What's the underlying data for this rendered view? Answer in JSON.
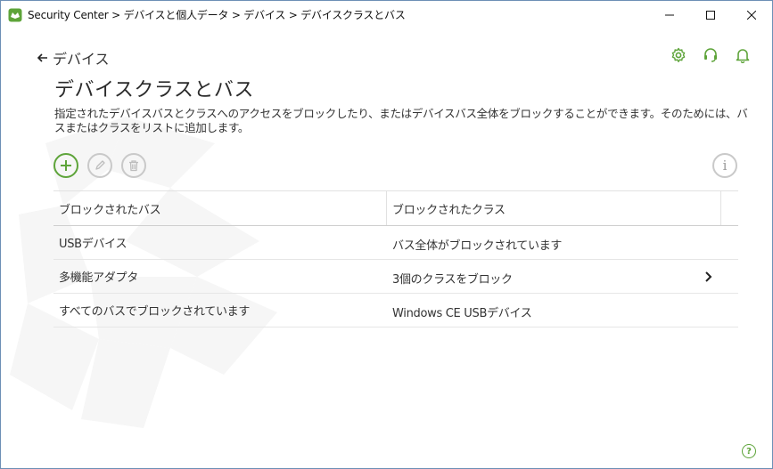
{
  "window": {
    "title": "Security Center > デバイスと個人データ > デバイス > デバイスクラスとバス",
    "controls": {
      "minimize": "minimize-icon",
      "maximize": "maximize-icon",
      "close": "close-icon"
    }
  },
  "nav": {
    "back_label": "デバイス"
  },
  "header_icons": [
    "gear-icon",
    "headset-icon",
    "bell-icon"
  ],
  "page": {
    "title": "デバイスクラスとバス",
    "description": "指定されたデバイスバスとクラスへのアクセスをブロックしたり、またはデバイスバス全体をブロックすることができます。そのためには、バスまたはクラスをリストに追加します。"
  },
  "toolbar": {
    "add": "plus-icon",
    "edit": "pencil-icon",
    "delete": "trash-icon",
    "info_glyph": "i"
  },
  "table": {
    "headers": [
      "ブロックされたバス",
      "ブロックされたクラス"
    ],
    "rows": [
      {
        "bus": "USBデバイス",
        "classes": "バス全体がブロックされています",
        "has_chevron": false
      },
      {
        "bus": "多機能アダプタ",
        "classes": "3個のクラスをブロック",
        "has_chevron": true
      },
      {
        "bus": "すべてのバスでブロックされています",
        "classes": "Windows CE USBデバイス",
        "has_chevron": false
      }
    ]
  },
  "help_glyph": "?",
  "colors": {
    "accent": "#5ea43a",
    "disabled": "#c9c9c9",
    "border": "#6d8fb5"
  }
}
